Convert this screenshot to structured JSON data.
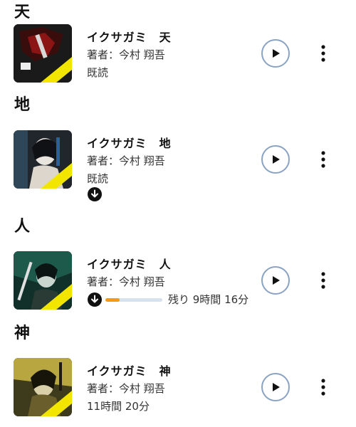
{
  "sections": [
    {
      "header": "天",
      "title": "イクサガミ　天",
      "author": "著者：今村 翔吾",
      "status": "既読",
      "has_download_icon": false,
      "progress": null,
      "remaining": null,
      "play_icon": "play-icon",
      "more_icon": "more-vertical-icon"
    },
    {
      "header": "地",
      "title": "イクサガミ　地",
      "author": "著者：今村 翔吾",
      "status": "既読",
      "has_download_icon": true,
      "progress": null,
      "remaining": null,
      "play_icon": "play-icon",
      "more_icon": "more-vertical-icon"
    },
    {
      "header": "人",
      "title": "イクサガミ　人",
      "author": "著者：今村 翔吾",
      "status": "",
      "has_download_icon": true,
      "progress": 0.25,
      "remaining": "残り 9時間 16分",
      "play_icon": "play-icon",
      "more_icon": "more-vertical-icon"
    },
    {
      "header": "神",
      "title": "イクサガミ　神",
      "author": "著者：今村 翔吾",
      "status": "11時間 20分",
      "has_download_icon": false,
      "progress": null,
      "remaining": null,
      "play_icon": "play-icon",
      "more_icon": "more-vertical-icon"
    }
  ],
  "colors": {
    "progress_fill": "#f59a17",
    "progress_track": "#d6e2ee",
    "play_ring": "#8aa3c2",
    "cover_band": "#f2e600"
  }
}
